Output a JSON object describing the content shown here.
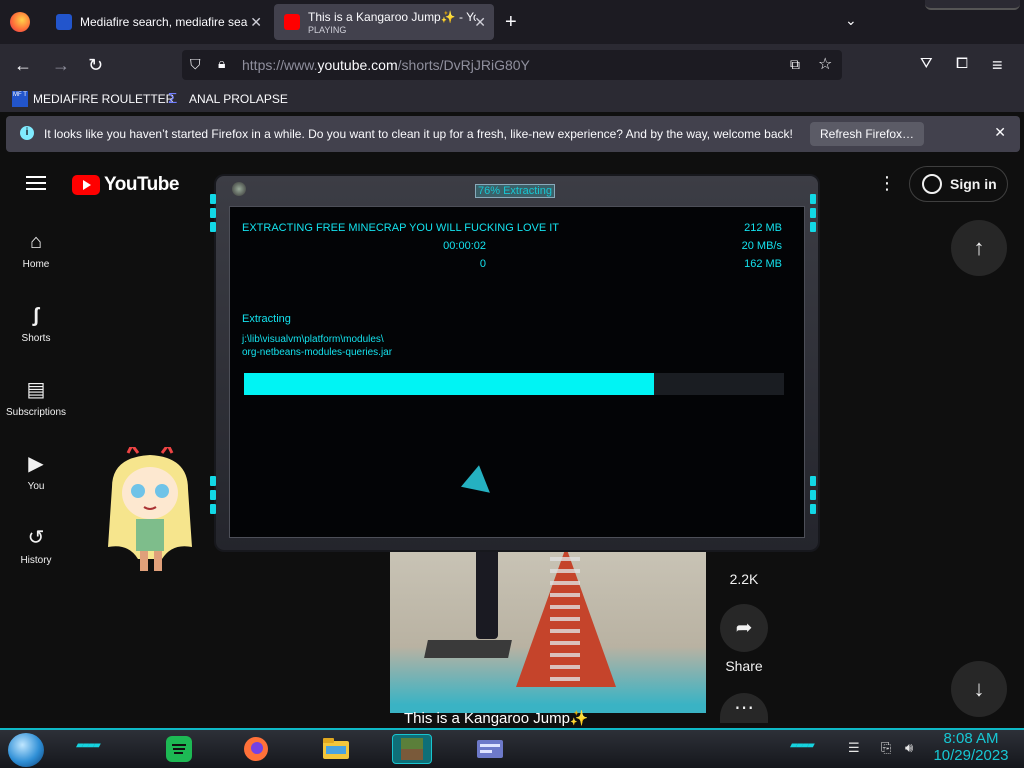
{
  "browser": {
    "tabs": [
      {
        "title": "Mediafire search, mediafire sea",
        "favicon": "mediafire-icon"
      },
      {
        "title": "This is a Kangaroo Jump✨ - Yo",
        "subtitle": "PLAYING",
        "favicon": "youtube-icon"
      }
    ],
    "url_prefix": "https://www.",
    "url_domain": "youtube.com",
    "url_path": "/shorts/DvRjJRiG80Y",
    "bookmarks": [
      {
        "label": "MEDIAFIRE ROULETTER",
        "icon": "mediafire-icon"
      },
      {
        "label": "ANAL PROLAPSE",
        "icon": "sigma-icon"
      }
    ],
    "notification": {
      "message": "It looks like you haven’t started Firefox in a while. Do you want to clean it up for a fresh, like-new experience? And by the way, welcome back!",
      "button": "Refresh Firefox…"
    }
  },
  "youtube": {
    "logo_text": "YouTube",
    "signin_label": "Sign in",
    "guide": [
      {
        "label": "Home",
        "icon": "home-icon"
      },
      {
        "label": "Shorts",
        "icon": "shorts-icon"
      },
      {
        "label": "Subscriptions",
        "icon": "subscriptions-icon"
      },
      {
        "label": "You",
        "icon": "you-icon"
      },
      {
        "label": "History",
        "icon": "history-icon"
      }
    ],
    "short": {
      "caption": "This is a Kangaroo Jump✨",
      "comments_count": "2.2K",
      "share_label": "Share"
    }
  },
  "extractor": {
    "title": "76% Extracting",
    "progress": 0.76,
    "heading": "EXTRACTING FREE MINECRAP YOU WILL FUCKING LOVE IT",
    "elapsed": "00:00:02",
    "remaining": "0",
    "total_size": "212 MB",
    "speed": "20 MB/s",
    "extracted_size": "162 MB",
    "status": "Extracting",
    "path_line1": "j:\\lib\\visualvm\\platform\\modules\\",
    "path_line2": "org-netbeans-modules-queries.jar"
  },
  "taskbar": {
    "time": "8:08 AM",
    "date": "10/29/2023",
    "accent_color": "#16d3df"
  }
}
